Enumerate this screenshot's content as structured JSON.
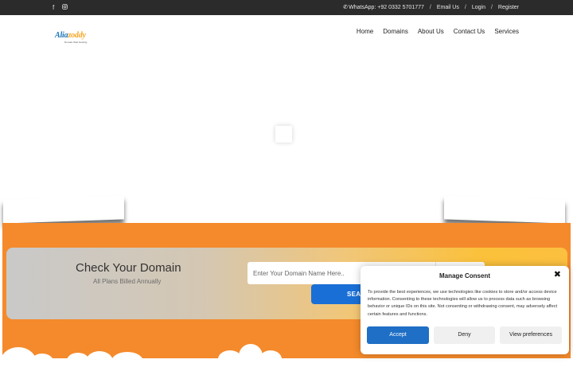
{
  "topbar": {
    "social_icons": [
      "facebook-icon",
      "instagram-icon"
    ],
    "whatsapp_icon_glyph": "✆",
    "whatsapp": "WhatsApp: +92 0332 5701777",
    "email": "Email Us",
    "login": "Login",
    "register": "Register",
    "separator": "/"
  },
  "header": {
    "logo_part1": "Alia",
    "logo_part2": "zoddy",
    "logo_tagline": "Domain Web Hosting",
    "nav": [
      "Home",
      "Domains",
      "About Us",
      "Contact Us",
      "Services"
    ]
  },
  "domain_search": {
    "title": "Check Your Domain",
    "subtitle": "All Plans Billed Annually",
    "placeholder": "Enter Your Domain Name Here..",
    "search_label": "SEA"
  },
  "consent": {
    "title": "Manage Consent",
    "text": "To provide the best experiences, we use technologies like cookies to store and/or access device information. Consenting to these technologies will allow us to process data such as browsing behavior or unique IDs on this site. Not consenting or withdrawing consent, may adversely affect certain features and functions.",
    "close_glyph": "✖",
    "accept": "Accept",
    "deny": "Deny",
    "preferences": "View preferences"
  },
  "colors": {
    "topbar": "#2b2b2b",
    "orange": "#f48a2c",
    "accent_blue": "#1e6fc5",
    "logo_blue": "#1a73b8",
    "logo_gold": "#f5a623"
  }
}
